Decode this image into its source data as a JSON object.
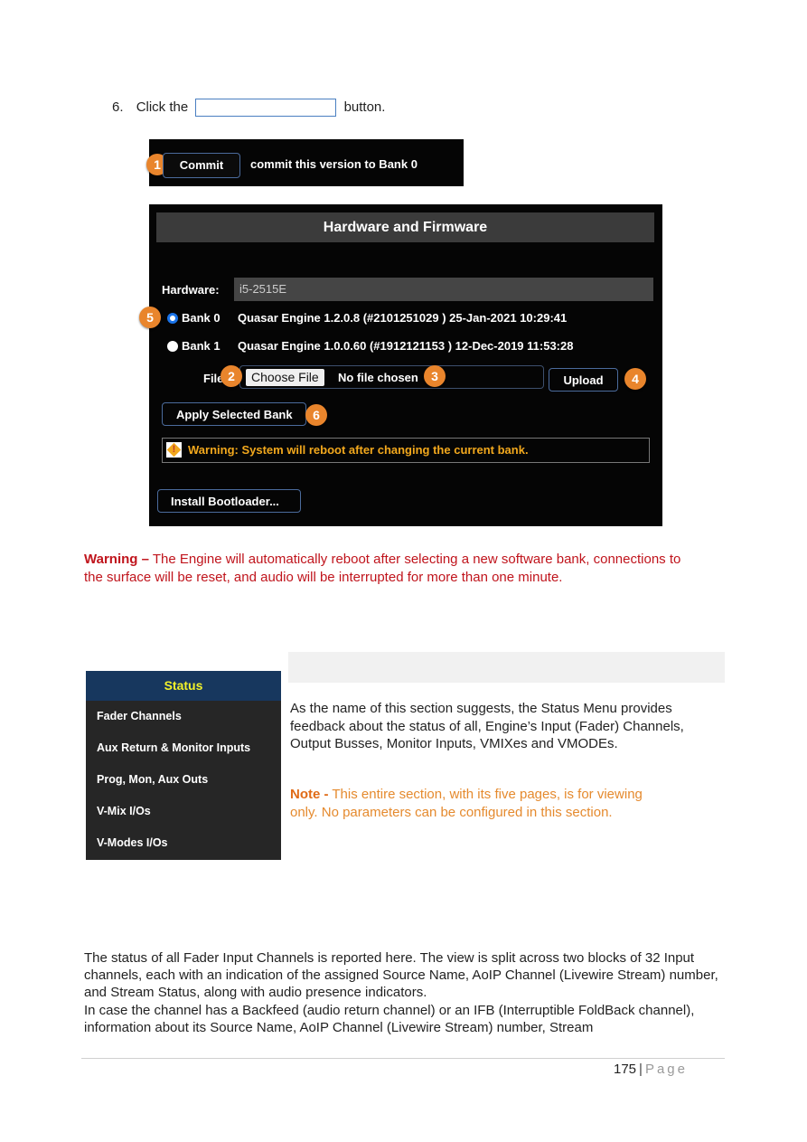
{
  "step": {
    "number": "6.",
    "prefix": "Click the",
    "suffix": "button."
  },
  "commit_strip": {
    "badge": "1",
    "button_label": "Commit",
    "description": "commit this version to Bank 0"
  },
  "hardware_panel": {
    "title": "Hardware and Firmware",
    "hardware_label": "Hardware:",
    "hardware_value": "i5-2515E",
    "banks": [
      {
        "badge": "5",
        "label": "Bank 0",
        "description": "Quasar Engine 1.2.0.8 (#2101251029 )  25-Jan-2021  10:29:41",
        "selected": true
      },
      {
        "label": "Bank 1",
        "description": "Quasar Engine 1.0.0.60 (#1912121153 )  12-Dec-2019  11:53:28",
        "selected": false
      }
    ],
    "file_label": "File",
    "choose_file_label": "Choose File",
    "no_file_text": "No file chosen",
    "upload_label": "Upload",
    "apply_label": "Apply Selected Bank",
    "warning_text": "Warning: System will reboot after changing the current bank.",
    "install_bootloader_label": "Install Bootloader...",
    "badges": {
      "choose_file": "2",
      "no_file": "3",
      "upload": "4",
      "apply": "6"
    }
  },
  "warning_paragraph": {
    "lead": "Warning –",
    "text": " The Engine will automatically reboot after selecting a new software bank, connections to the surface will be reset, and audio will be interrupted for more than one minute."
  },
  "status_menu": {
    "title": "Status",
    "items": [
      "Fader Channels",
      "Aux Return & Monitor Inputs",
      "Prog, Mon, Aux Outs",
      "V-Mix I/Os",
      "V-Modes I/Os"
    ]
  },
  "status_paragraph": "As the name of this section suggests, the Status Menu provides feedback about the status of all, Engine’s Input (Fader) Channels, Output Busses, Monitor Inputs, VMIXes and VMODEs.",
  "note": {
    "lead": "Note -",
    "text": " This entire section, with its five pages, is for viewing only. No parameters can be configured in this section."
  },
  "body_paragraph_1": "The status of all  Fader Input Channels is reported here. The view is split across two blocks of 32 Input channels, each with an indication of the assigned Source Name, AoIP Channel (Livewire Stream) number, and  Stream Status, along with audio presence indicators.",
  "body_paragraph_2": "In case the channel has a Backfeed (audio return channel) or an IFB (Interruptible FoldBack channel), information about its Source Name, AoIP Channel (Livewire Stream) number, Stream",
  "footer": {
    "page_number": "175",
    "separator": "|",
    "page_word": "Page"
  },
  "colors": {
    "badge": "#e9852c",
    "warning_red": "#c0141c",
    "note_orange": "#e58a2e",
    "status_header_bg": "#17375e",
    "status_header_text": "#f2f22a",
    "panel_warning_text": "#f2a81d"
  }
}
